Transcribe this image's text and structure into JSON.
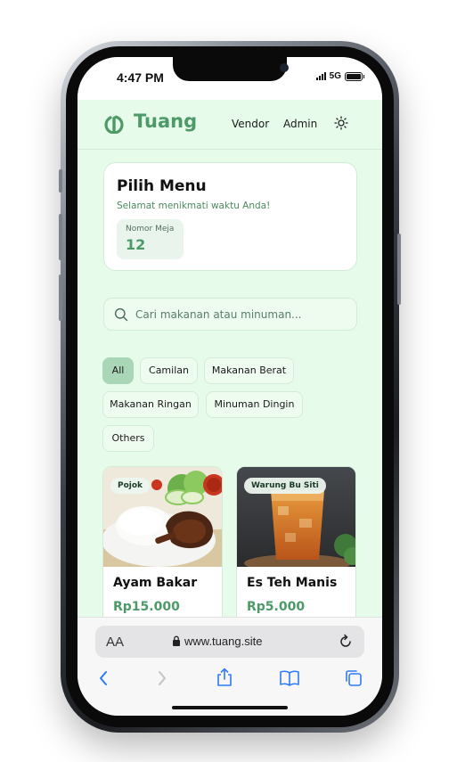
{
  "status_bar": {
    "time": "4:47 PM",
    "network": "5G"
  },
  "app": {
    "brand": "Tuang",
    "nav": {
      "vendor": "Vendor",
      "admin": "Admin"
    },
    "theme_icon": "sun-icon",
    "accent_color": "#4c9a67",
    "background_color": "#e6fbe9"
  },
  "menu_card": {
    "title": "Pilih Menu",
    "subtitle": "Selamat menikmati waktu Anda!",
    "table_label": "Nomor Meja",
    "table_number": "12"
  },
  "search": {
    "placeholder": "Cari makanan atau minuman..."
  },
  "categories": [
    {
      "label": "All",
      "active": true
    },
    {
      "label": "Camilan",
      "active": false
    },
    {
      "label": "Makanan Berat",
      "active": false
    },
    {
      "label": "Makanan Ringan",
      "active": false
    },
    {
      "label": "Minuman Dingin",
      "active": false
    },
    {
      "label": "Others",
      "active": false
    }
  ],
  "items": [
    {
      "vendor": "Pojok",
      "name": "Ayam Bakar",
      "price": "Rp15.000"
    },
    {
      "vendor": "Warung Bu Siti",
      "name": "Es Teh Manis",
      "price": "Rp5.000"
    }
  ],
  "browser": {
    "text_size": "AA",
    "url": "www.tuang.site",
    "toolbar_icons": [
      "back-icon",
      "forward-icon",
      "share-icon",
      "bookmarks-icon",
      "tabs-icon"
    ]
  }
}
